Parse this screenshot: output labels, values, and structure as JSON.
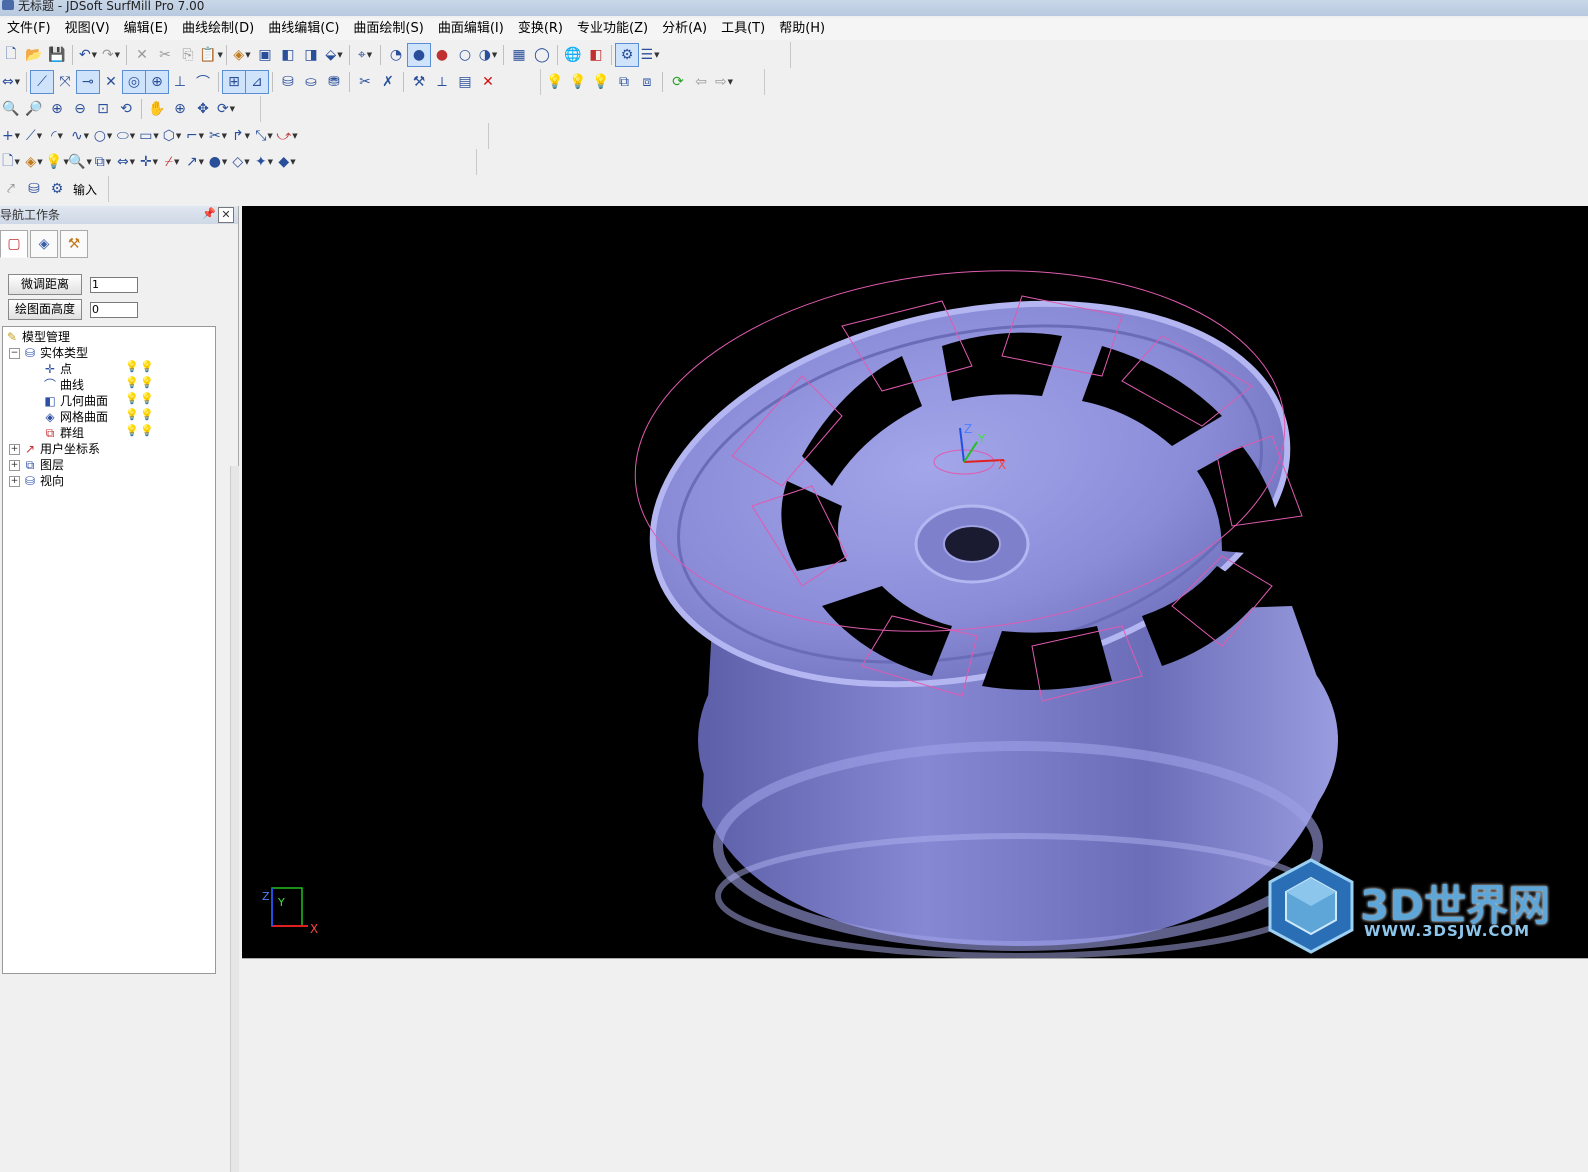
{
  "window": {
    "title": "无标题 - JDSoft SurfMill Pro 7.00"
  },
  "menu": [
    "文件(F)",
    "视图(V)",
    "编辑(E)",
    "曲线绘制(D)",
    "曲线编辑(C)",
    "曲面绘制(S)",
    "曲面编辑(I)",
    "变换(R)",
    "专业功能(Z)",
    "分析(A)",
    "工具(T)",
    "帮助(H)"
  ],
  "toolbar_small": {
    "import_label": "输入"
  },
  "panel": {
    "title": "导航工作条",
    "fine_tune_label": "微调距离",
    "fine_tune_value": "1",
    "draw_height_label": "绘图面高度",
    "draw_height_value": "0"
  },
  "tree": {
    "root": "模型管理",
    "entity_types": "实体类型",
    "point": "点",
    "curve": "曲线",
    "geom_surface": "几何曲面",
    "mesh_surface": "网格曲面",
    "group": "群组",
    "ucs": "用户坐标系",
    "layers": "图层",
    "views": "视向"
  },
  "viewport": {
    "axis": {
      "x": "X",
      "y": "Y",
      "z": "Z"
    },
    "model_color": "#8a8bd6",
    "toolpath_color": "#e05bb0"
  },
  "watermark": {
    "title": "3D世界网",
    "url": "WWW.3DSJW.COM"
  }
}
